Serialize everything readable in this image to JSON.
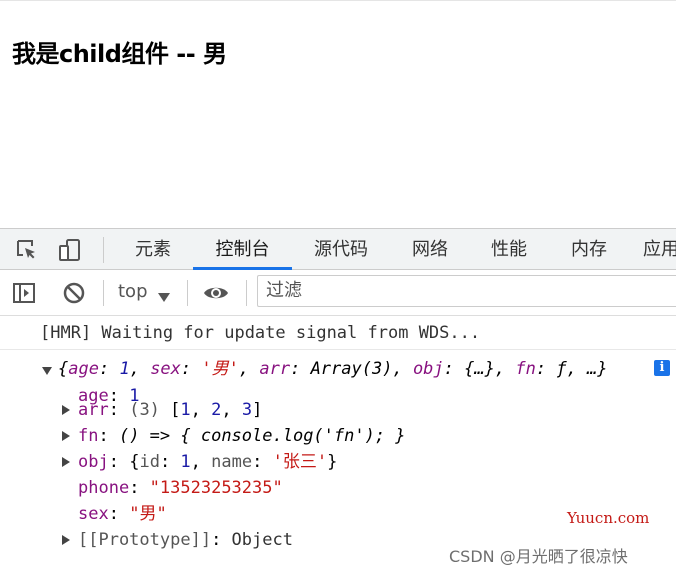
{
  "page": {
    "heading": "我是child组件 -- 男"
  },
  "devtools": {
    "tabs": [
      {
        "label": "元素",
        "active": false
      },
      {
        "label": "控制台",
        "active": true
      },
      {
        "label": "源代码",
        "active": false
      },
      {
        "label": "网络",
        "active": false
      },
      {
        "label": "性能",
        "active": false
      },
      {
        "label": "内存",
        "active": false
      },
      {
        "label": "应用",
        "active": false
      }
    ],
    "toolbar": {
      "context": "top",
      "filter_placeholder": "过滤"
    },
    "console": {
      "hmr_message": "[HMR] Waiting for update signal from WDS...",
      "summary": {
        "open": "{",
        "age_key": "age",
        "age_val": "1",
        "sex_key": "sex",
        "sex_val": "'男'",
        "arr_key": "arr",
        "arr_val": "Array(3)",
        "obj_key": "obj",
        "obj_val": "{…}",
        "fn_key": "fn",
        "fn_val": "ƒ",
        "close": "…}"
      },
      "props": {
        "age": {
          "key": "age",
          "value": "1"
        },
        "arr": {
          "key": "arr",
          "len": "(3)",
          "open": "[",
          "v1": "1",
          "v2": "2",
          "v3": "3",
          "close": "]"
        },
        "fn": {
          "key": "fn",
          "value": "() => { console.log('fn'); }"
        },
        "obj": {
          "key": "obj",
          "open": "{",
          "id_key": "id",
          "id_val": "1",
          "name_key": "name",
          "name_val": "'张三'",
          "close": "}"
        },
        "phone": {
          "key": "phone",
          "value": "\"13523253235\""
        },
        "sex": {
          "key": "sex",
          "value": "\"男\""
        },
        "proto": {
          "key": "[[Prototype]]",
          "value": "Object"
        }
      }
    }
  },
  "watermarks": {
    "site": "Yuucn.com",
    "csdn": "CSDN @月光晒了很凉快"
  }
}
